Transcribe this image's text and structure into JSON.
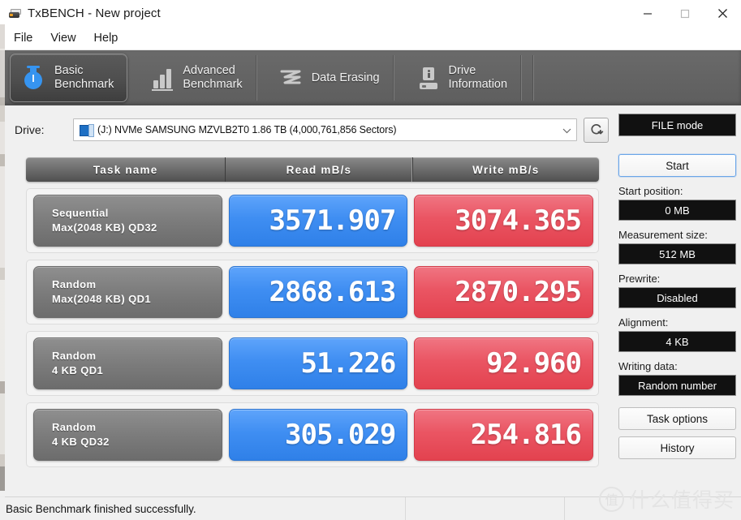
{
  "window": {
    "title": "TxBENCH - New project",
    "icon": "drive-icon",
    "controls": {
      "minimize": "minimize-icon",
      "maximize": "maximize-icon",
      "close": "close-icon"
    }
  },
  "menubar": {
    "items": [
      "File",
      "View",
      "Help"
    ]
  },
  "tabs": [
    {
      "label": "Basic\nBenchmark",
      "icon": "stopwatch-icon",
      "active": true
    },
    {
      "label": "Advanced\nBenchmark",
      "icon": "bar-chart-icon",
      "active": false
    },
    {
      "label": "Data Erasing",
      "icon": "erase-icon",
      "active": false
    },
    {
      "label": "Drive\nInformation",
      "icon": "drive-info-icon",
      "active": false
    }
  ],
  "drive": {
    "label": "Drive:",
    "selected": "(J:) NVMe SAMSUNG MZVLB2T0  1.86 TB (4,000,761,856 Sectors)",
    "icon": "hdd-icon",
    "caret": "chevron-down-icon",
    "refresh_icon": "refresh-icon"
  },
  "table": {
    "headers": [
      "Task name",
      "Read mB/s",
      "Write mB/s"
    ],
    "rows": [
      {
        "task_line1": "Sequential",
        "task_line2": "Max(2048 KB) QD32",
        "read": "3571.907",
        "write": "3074.365"
      },
      {
        "task_line1": "Random",
        "task_line2": "Max(2048 KB) QD1",
        "read": "2868.613",
        "write": "2870.295"
      },
      {
        "task_line1": "Random",
        "task_line2": "4 KB QD1",
        "read": "51.226",
        "write": "92.960"
      },
      {
        "task_line1": "Random",
        "task_line2": "4 KB QD32",
        "read": "305.029",
        "write": "254.816"
      }
    ]
  },
  "panel": {
    "mode": "FILE mode",
    "start_button": "Start",
    "start_position_label": "Start position:",
    "start_position_value": "0 MB",
    "measurement_size_label": "Measurement size:",
    "measurement_size_value": "512 MB",
    "prewrite_label": "Prewrite:",
    "prewrite_value": "Disabled",
    "alignment_label": "Alignment:",
    "alignment_value": "4 KB",
    "writing_data_label": "Writing data:",
    "writing_data_value": "Random number",
    "task_options_button": "Task options",
    "history_button": "History"
  },
  "statusbar": {
    "message": "Basic Benchmark finished successfully.",
    "segment2": "",
    "segment3": ""
  },
  "watermark": {
    "badge": "值",
    "text": "什么值得买"
  },
  "colors": {
    "read_blue": "#3f8ef2",
    "write_red": "#ea5563",
    "tab_strip": "#656565",
    "task_gray": "#7c7c7c",
    "panel_dark": "#111111"
  }
}
